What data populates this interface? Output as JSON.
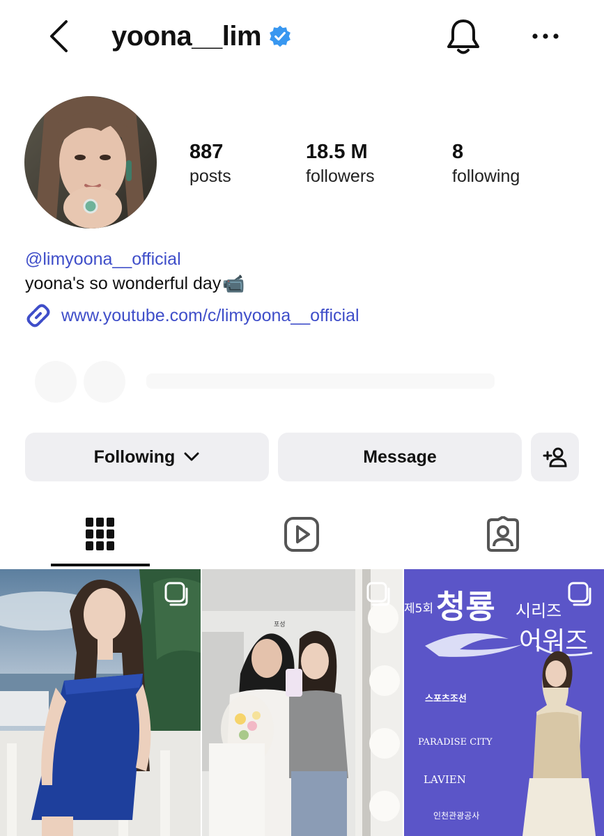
{
  "header": {
    "username": "yoona__lim",
    "verified": true,
    "back_icon": "chevron-left-icon",
    "bell_icon": "bell-icon",
    "more_icon": "more-horizontal-icon"
  },
  "stats": {
    "posts": {
      "value": "887",
      "label": "posts"
    },
    "followers": {
      "value": "18.5 M",
      "label": "followers"
    },
    "following": {
      "value": "8",
      "label": "following"
    }
  },
  "bio": {
    "mention": "@limyoona__official",
    "text": "yoona's so wonderful day",
    "emoji": "📹",
    "link": "www.youtube.com/c/limyoona__official"
  },
  "actions": {
    "following_label": "Following",
    "message_label": "Message",
    "add_user_icon": "add-user-icon"
  },
  "tabs": [
    {
      "icon": "grid-icon",
      "active": true
    },
    {
      "icon": "reels-icon",
      "active": false
    },
    {
      "icon": "tagged-icon",
      "active": false
    }
  ],
  "posts": [
    {
      "multi": true
    },
    {
      "multi": true,
      "note": "포성"
    },
    {
      "multi": true,
      "title_prefix": "제5회",
      "title_main": "청룡",
      "title_suffix": "시리즈",
      "title_line2": "어워즈",
      "sponsors": [
        "스포츠조선",
        "PARADISE CITY",
        "LAVIEN",
        "인천관광공사"
      ]
    }
  ],
  "colors": {
    "link": "#3f4ec9",
    "verified_badge": "#3897f0",
    "button_bg": "#efeff2",
    "awards_backdrop": "#5b55c8"
  }
}
